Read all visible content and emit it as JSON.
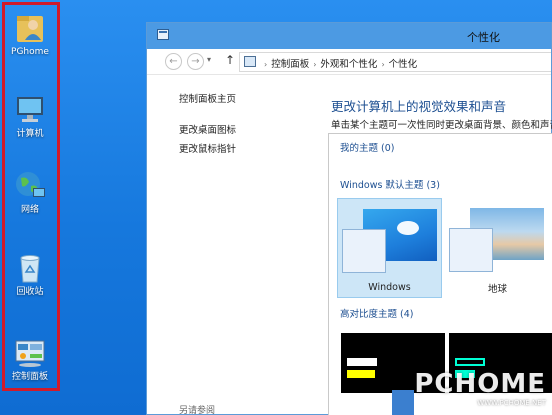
{
  "desktop": {
    "icons": [
      {
        "label": "PGhome",
        "icon": "user-folder-icon"
      },
      {
        "label": "计算机",
        "icon": "computer-icon"
      },
      {
        "label": "网络",
        "icon": "network-globe-icon"
      },
      {
        "label": "回收站",
        "icon": "recycle-bin-icon"
      },
      {
        "label": "控制面板",
        "icon": "control-panel-icon"
      }
    ],
    "highlight_color": "#d11a2a"
  },
  "window": {
    "title": "个性化",
    "nav": {
      "back": "←",
      "forward": "→",
      "dropdown": "▾",
      "up": "↑"
    },
    "breadcrumb": [
      "控制面板",
      "外观和个性化",
      "个性化"
    ],
    "breadcrumb_sep": "›",
    "sidebar": {
      "home": "控制面板主页",
      "links": [
        "更改桌面图标",
        "更改鼠标指针"
      ],
      "see_also": "另请参阅"
    },
    "main": {
      "heading": "更改计算机上的视觉效果和声音",
      "subtitle": "单击某个主题可一次性同时更改桌面背景、颜色和声音"
    },
    "themes": {
      "my_themes": {
        "label": "我的主题",
        "count": "(0)"
      },
      "default_themes": {
        "label": "Windows 默认主题",
        "count": "(3)"
      },
      "items": [
        {
          "name": "Windows",
          "selected": true
        },
        {
          "name": "地球",
          "selected": false
        }
      ],
      "high_contrast": {
        "label": "高对比度主题",
        "count": "(4)"
      }
    }
  },
  "watermark": {
    "big": "PCHOME",
    "small": "WWW.PCHOME.NET"
  },
  "colors": {
    "accent": "#4c9ae3",
    "link_blue": "#1d4f91",
    "selected_bg": "#cde6f7"
  }
}
